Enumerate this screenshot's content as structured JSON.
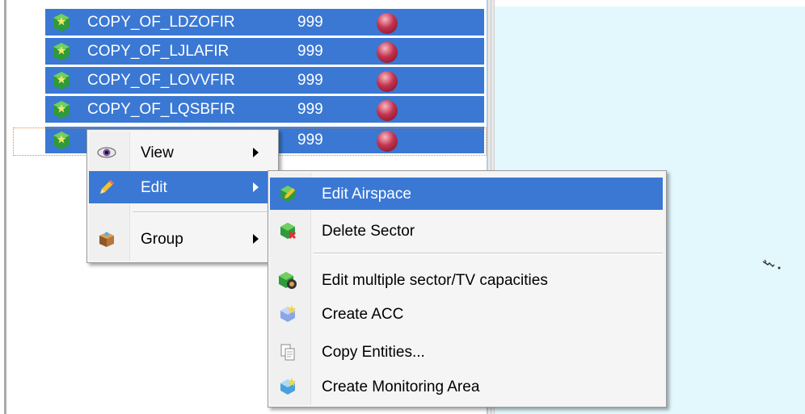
{
  "list": {
    "rows": [
      {
        "name": "COPY_OF_LDZOFIR",
        "value": "999",
        "status": "red"
      },
      {
        "name": "COPY_OF_LJLAFIR",
        "value": "999",
        "status": "red"
      },
      {
        "name": "COPY_OF_LOVVFIR",
        "value": "999",
        "status": "red"
      },
      {
        "name": "COPY_OF_LQSBFIR",
        "value": "999",
        "status": "red"
      },
      {
        "name": "",
        "value": "999",
        "status": "red"
      }
    ]
  },
  "context_menu": {
    "items": [
      {
        "label": "View",
        "icon": "eye-icon",
        "submenu": true
      },
      {
        "label": "Edit",
        "icon": "pencil-icon",
        "submenu": true,
        "highlighted": true
      },
      {
        "label": "Group",
        "icon": "box-icon",
        "submenu": true
      }
    ]
  },
  "edit_submenu": {
    "items": [
      {
        "label": "Edit Airspace",
        "icon": "edit-airspace-icon",
        "highlighted": true
      },
      {
        "label": "Delete Sector",
        "icon": "delete-sector-icon"
      },
      {
        "label": "Edit multiple sector/TV capacities",
        "icon": "capacities-icon"
      },
      {
        "label": "Create ACC",
        "icon": "create-acc-icon"
      },
      {
        "label": "Copy Entities...",
        "icon": "copy-entities-icon"
      },
      {
        "label": "Create Monitoring Area",
        "icon": "monitoring-area-icon"
      }
    ]
  },
  "colors": {
    "selection": "#3a78d4",
    "map_background": "#e3f8fc",
    "status_red": "#c2334f"
  }
}
